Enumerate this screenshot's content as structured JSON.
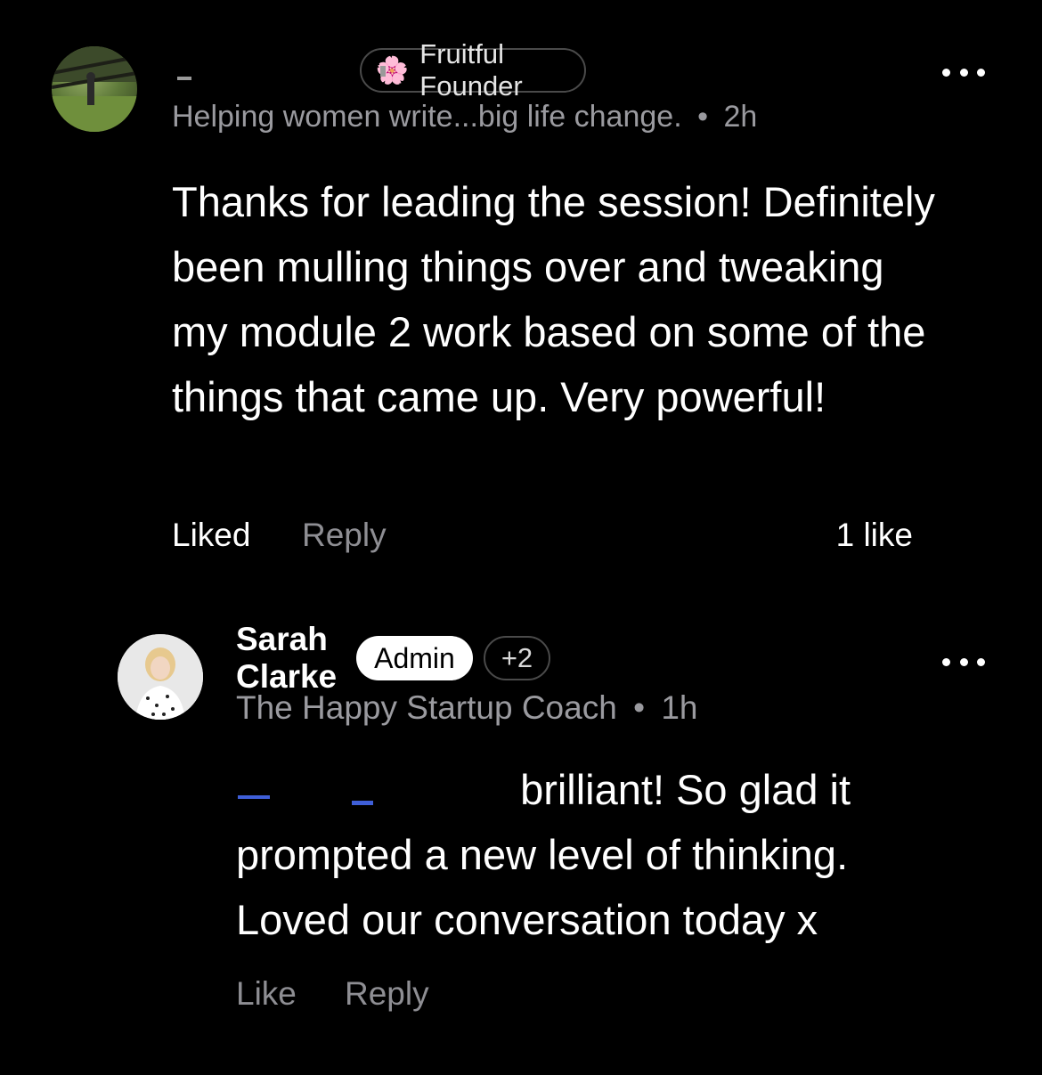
{
  "comments": [
    {
      "author_name": "",
      "badge": {
        "icon": "cherry-blossom-icon",
        "glyph": "🌸",
        "label": "Fruitful Founder"
      },
      "subtitle": "Helping women write...big life change.",
      "separator": "•",
      "time": "2h",
      "body": "Thanks for leading the session! Definitely been mulling things over and tweaking my module 2 work based on some of the things that came up. Very powerful!",
      "actions": {
        "like_label": "Liked",
        "reply_label": "Reply",
        "likes_count": "1 like"
      }
    },
    {
      "author_name": "Sarah Clarke",
      "badge": {
        "label": "Admin"
      },
      "extra_badges": "+2",
      "subtitle": "The Happy Startup Coach",
      "separator": "•",
      "time": "1h",
      "body_after_mention": "brilliant! So glad it prompted a new level of thinking. Loved our conversation today x",
      "actions": {
        "like_label": "Like",
        "reply_label": "Reply"
      }
    }
  ],
  "colors": {
    "background": "#000000",
    "text_primary": "#ffffff",
    "text_secondary": "#9a9a9f",
    "mention": "#3f5fd8",
    "admin_badge_bg": "#ffffff"
  }
}
